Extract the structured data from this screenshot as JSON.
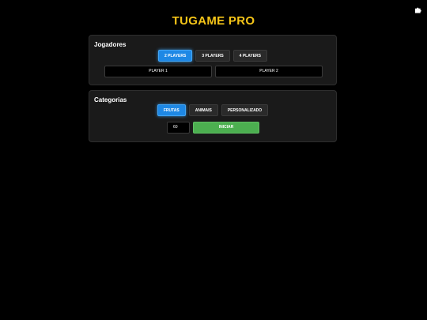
{
  "header": {
    "title": "TUGAME PRO",
    "corner_icon": "puzzle-icon",
    "title_color": "#f5c518"
  },
  "players": {
    "heading": "Jogadores",
    "options": [
      {
        "label": "2 PLAYERS",
        "active": true
      },
      {
        "label": "3 PLAYERS",
        "active": false
      },
      {
        "label": "4 PLAYERS",
        "active": false
      }
    ],
    "names": [
      "PLAYER 1",
      "PLAYER 2"
    ]
  },
  "categories": {
    "heading": "Categorias",
    "options": [
      {
        "label": "FRUTAS",
        "active": true
      },
      {
        "label": "ANIMAIS",
        "active": false
      },
      {
        "label": "PERSONALIZADO",
        "active": false
      }
    ],
    "time_value": "60",
    "start_label": "INICIAR"
  },
  "colors": {
    "accent_blue": "#1e88e5",
    "start_green": "#4caf50"
  }
}
